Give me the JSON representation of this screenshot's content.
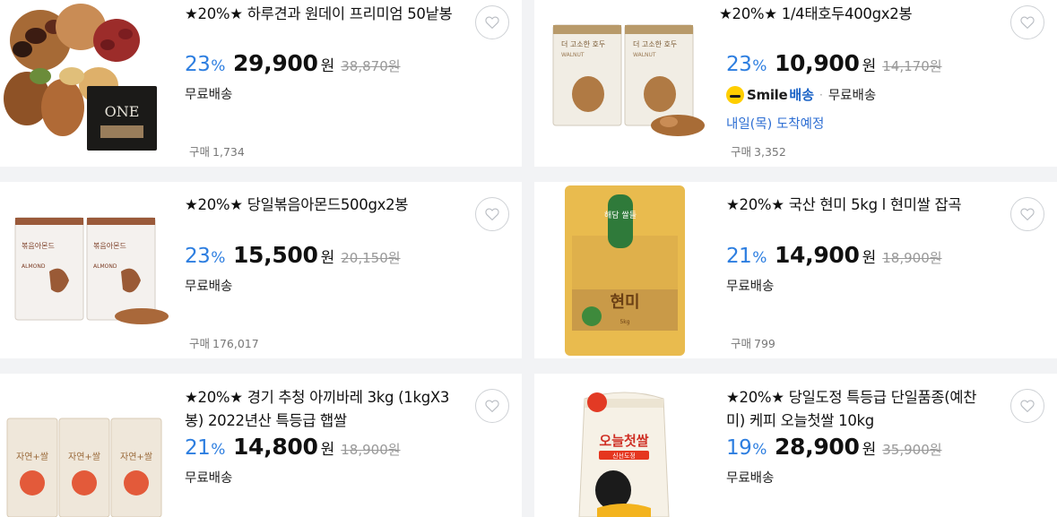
{
  "products": [
    {
      "title": "★20%★ 하루견과 원데이 프리미엄 50낱봉",
      "discount": "23",
      "discount_unit": "%",
      "price": "29,900",
      "price_unit": "원",
      "original_price": "38,870원",
      "shipping": "무료배송",
      "purchase_label": "구매",
      "purchase_count": "1,734",
      "image": "mixed-nuts-photo",
      "image_text": "ONE"
    },
    {
      "title": "★20%★ 1/4태호두400gx2봉",
      "discount": "23",
      "discount_unit": "%",
      "price": "10,900",
      "price_unit": "원",
      "original_price": "14,170원",
      "smile_label": "Smile",
      "smile_delivery": "배송",
      "shipping": "무료배송",
      "delivery_eta": "내일(목) 도착예정",
      "purchase_label": "구매",
      "purchase_count": "3,352",
      "image": "walnut-bags-photo",
      "bag_label": "더 고소한 호두",
      "bag_sub": "WALNUT"
    },
    {
      "title": "★20%★ 당일볶음아몬드500gx2봉",
      "discount": "23",
      "discount_unit": "%",
      "price": "15,500",
      "price_unit": "원",
      "original_price": "20,150원",
      "shipping": "무료배송",
      "purchase_label": "구매",
      "purchase_count": "176,017",
      "image": "almond-bags-photo",
      "bag_label": "볶음아몬드",
      "bag_sub": "ALMOND"
    },
    {
      "title": "★20%★ 국산 현미 5kg l 현미쌀 잡곡",
      "discount": "21",
      "discount_unit": "%",
      "price": "14,900",
      "price_unit": "원",
      "original_price": "18,900원",
      "shipping": "무료배송",
      "purchase_label": "구매",
      "purchase_count": "799",
      "image": "brown-rice-bag-photo",
      "bag_label": "현미",
      "bag_badge": "해담 쌀들",
      "bag_weight": "5kg"
    },
    {
      "title": "★20%★ 경기 추청 아끼바레 3kg (1kgX3봉) 2022년산 특등급 햅쌀",
      "discount": "21",
      "discount_unit": "%",
      "price": "14,800",
      "price_unit": "원",
      "original_price": "18,900원",
      "shipping": "무료배송",
      "image": "rice-packs-photo",
      "bag_label": "자연+쌀"
    },
    {
      "title": "★20%★ 당일도정 특등급 단일품종(예찬미) 케피 오늘첫쌀 10kg",
      "discount": "19",
      "discount_unit": "%",
      "price": "28,900",
      "price_unit": "원",
      "original_price": "35,900원",
      "shipping": "무료배송",
      "image": "rice-bag-photo",
      "bag_label": "오늘첫쌀",
      "bag_sub": "신선도정"
    }
  ],
  "colors": {
    "discount": "#2d7ee0",
    "eta": "#2d6ed3",
    "smile_yellow": "#ffce00"
  }
}
